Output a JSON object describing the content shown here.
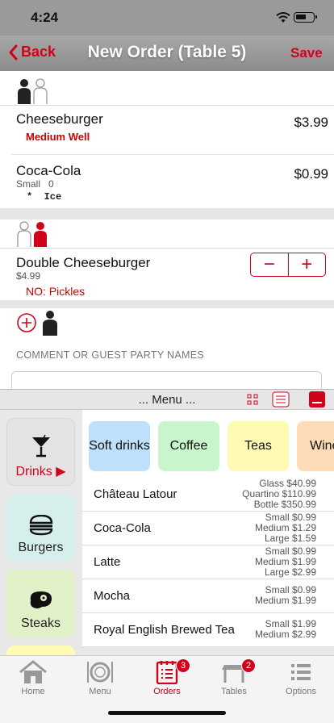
{
  "status": {
    "time": "4:24"
  },
  "nav": {
    "back_label": "Back",
    "title": "New Order (Table 5)",
    "save_label": "Save"
  },
  "order": {
    "guest1_items": [
      {
        "name": "Cheeseburger",
        "price": "$3.99",
        "modifier": "Medium Well"
      },
      {
        "name": "Coca-Cola",
        "price": "$0.99",
        "detail": "Small   0",
        "modifier": "*  Ice"
      }
    ],
    "guest2_items": [
      {
        "name": "Double Cheeseburger",
        "price": "$4.99",
        "modifier": "NO: Pickles"
      }
    ],
    "stepper": {
      "minus": "−",
      "plus": "+"
    },
    "comment_label": "COMMENT OR GUEST PARTY NAMES",
    "comment_value": ""
  },
  "menu": {
    "title": "... Menu ...",
    "categories": [
      {
        "label": "Drinks ▶",
        "icon": "cocktail-icon",
        "color": "#e3e3e3",
        "text_color": "#d0021b"
      },
      {
        "label": "Burgers",
        "icon": "burger-icon",
        "color": "#d7efec",
        "text_color": "#111"
      },
      {
        "label": "Steaks",
        "icon": "steak-icon",
        "color": "#e2f0c8",
        "text_color": "#111"
      }
    ],
    "subcategories": [
      {
        "label": "Soft drinks",
        "color": "#bfe0fb"
      },
      {
        "label": "Coffee",
        "color": "#c9f5cd"
      },
      {
        "label": "Teas",
        "color": "#fffbb5"
      },
      {
        "label": "Wine",
        "color": "#ffdcb8"
      }
    ],
    "products": [
      {
        "name": "Château Latour",
        "prices": [
          "Glass  $40.99",
          "Quartino  $110.99",
          "Bottle  $350.99"
        ]
      },
      {
        "name": "Coca-Cola",
        "prices": [
          "Small  $0.99",
          "Medium  $1.29",
          "Large  $1.59"
        ]
      },
      {
        "name": "Latte",
        "prices": [
          "Small  $0.99",
          "Medium  $1.99",
          "Large  $2.99"
        ]
      },
      {
        "name": "Mocha",
        "prices": [
          "Small  $0.99",
          "Medium  $1.99"
        ]
      },
      {
        "name": "Royal English Brewed Tea",
        "prices": [
          "Small  $1.99",
          "Medium  $2.99"
        ]
      }
    ]
  },
  "tabbar": {
    "tabs": [
      {
        "label": "Home",
        "icon": "home-icon"
      },
      {
        "label": "Menu",
        "icon": "plate-icon"
      },
      {
        "label": "Orders",
        "icon": "orders-icon",
        "badge": "3"
      },
      {
        "label": "Tables",
        "icon": "table-icon",
        "badge": "2"
      },
      {
        "label": "Options",
        "icon": "options-icon"
      }
    ]
  },
  "colors": {
    "accent": "#d0021b",
    "navbar": "#9a9a9a"
  }
}
